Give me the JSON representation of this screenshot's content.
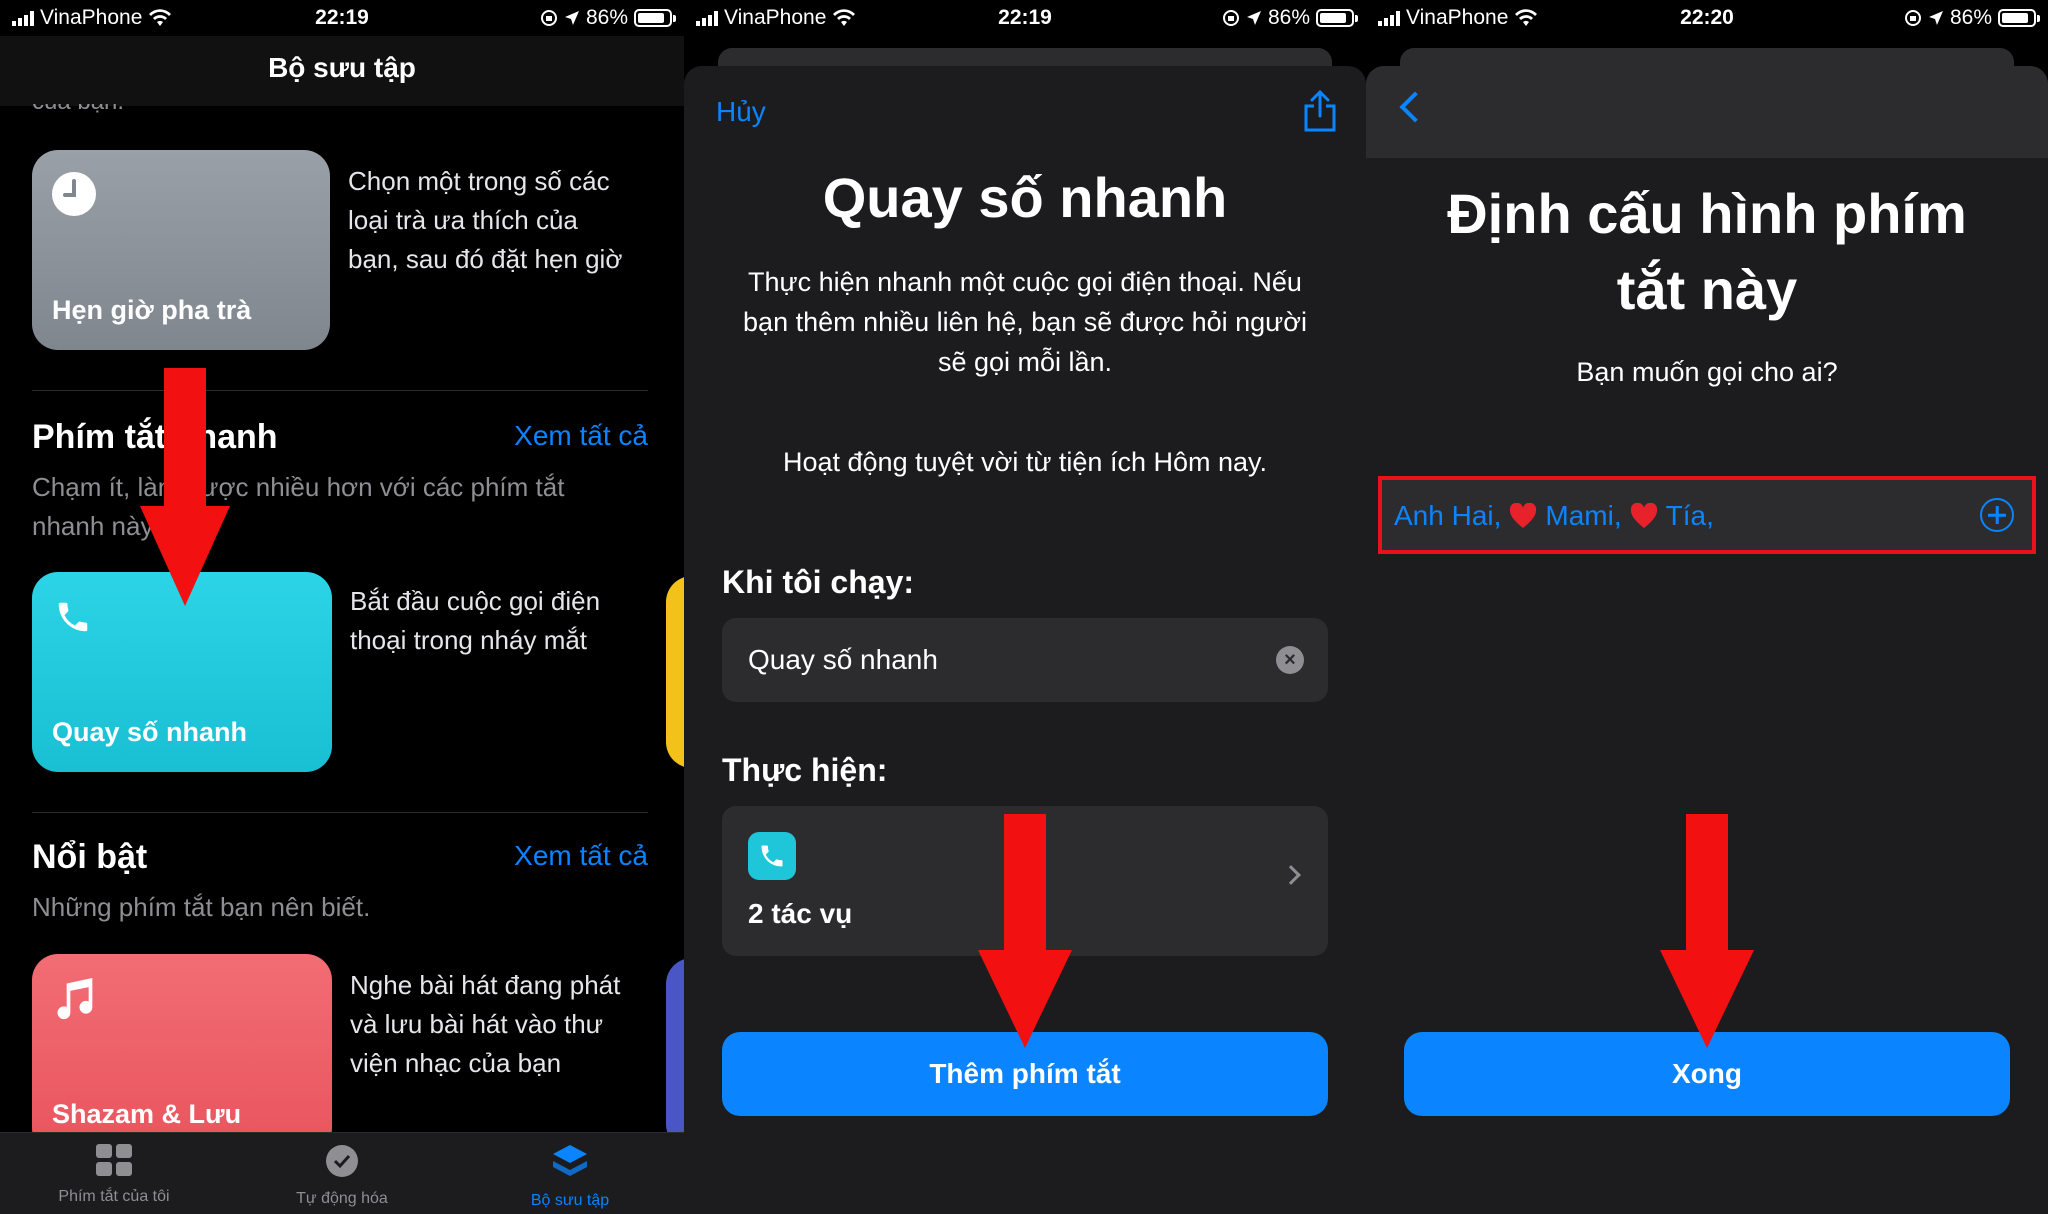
{
  "status_bars": [
    {
      "carrier": "VinaPhone",
      "time": "22:19",
      "battery": "86%"
    },
    {
      "carrier": "VinaPhone",
      "time": "22:19",
      "battery": "86%"
    },
    {
      "carrier": "VinaPhone",
      "time": "22:20",
      "battery": "86%"
    }
  ],
  "gallery": {
    "title": "Bộ sưu tập",
    "cutoff_text": "của bạn.",
    "tea_card": {
      "label": "Hẹn giờ pha trà",
      "desc": [
        "Chọn một trong số các",
        "loại trà ưa thích của",
        "bạn, sau đó đặt hẹn giờ"
      ]
    },
    "quick_section": {
      "heading": "Phím tắt nhanh",
      "see_all": "Xem tất cả",
      "sub": [
        "Chạm ít, làm được nhiều hơn với các phím tắt",
        "nhanh này."
      ]
    },
    "dial_card": {
      "label": "Quay số nhanh",
      "desc": [
        "Bắt đầu cuộc gọi điện",
        "thoại trong nháy mắt"
      ]
    },
    "featured_section": {
      "heading": "Nổi bật",
      "see_all": "Xem tất cả",
      "sub": "Những phím tắt bạn nên biết."
    },
    "shazam_card": {
      "label": "Shazam & Lưu",
      "desc": [
        "Nghe bài hát đang phát",
        "và lưu bài hát vào thư",
        "viện nhạc của bạn"
      ]
    },
    "tabs": [
      {
        "label": "Phím tắt của tôi",
        "icon": "grid-icon"
      },
      {
        "label": "Tự động hóa",
        "icon": "clock-check-icon"
      },
      {
        "label": "Bộ sưu tập",
        "icon": "layers-icon"
      }
    ],
    "colors": {
      "tea_card": "#8e949c",
      "dial_card": "#1fc6d9",
      "shazam_card": "#ee5a63",
      "accent": "#0a84ff"
    }
  },
  "detail": {
    "cancel": "Hủy",
    "title": "Quay số nhanh",
    "description": [
      "Thực hiện nhanh một cuộc gọi điện thoại. Nếu",
      "bạn thêm nhiều liên hệ, bạn sẽ được hỏi người",
      "sẽ gọi mỗi lần."
    ],
    "widget_note": "Hoạt động tuyệt vời từ tiện ích Hôm nay.",
    "when_run_label": "Khi tôi chạy:",
    "name_value": "Quay số nhanh",
    "do_label": "Thực hiện:",
    "action_count": "2 tác vụ",
    "add_button": "Thêm phím tắt"
  },
  "configure": {
    "title": [
      "Định cấu hình phím",
      "tắt này"
    ],
    "question": "Bạn muốn gọi cho ai?",
    "contacts": [
      "Anh Hai,",
      "Mami,",
      "Tía,"
    ],
    "done_button": "Xong"
  }
}
